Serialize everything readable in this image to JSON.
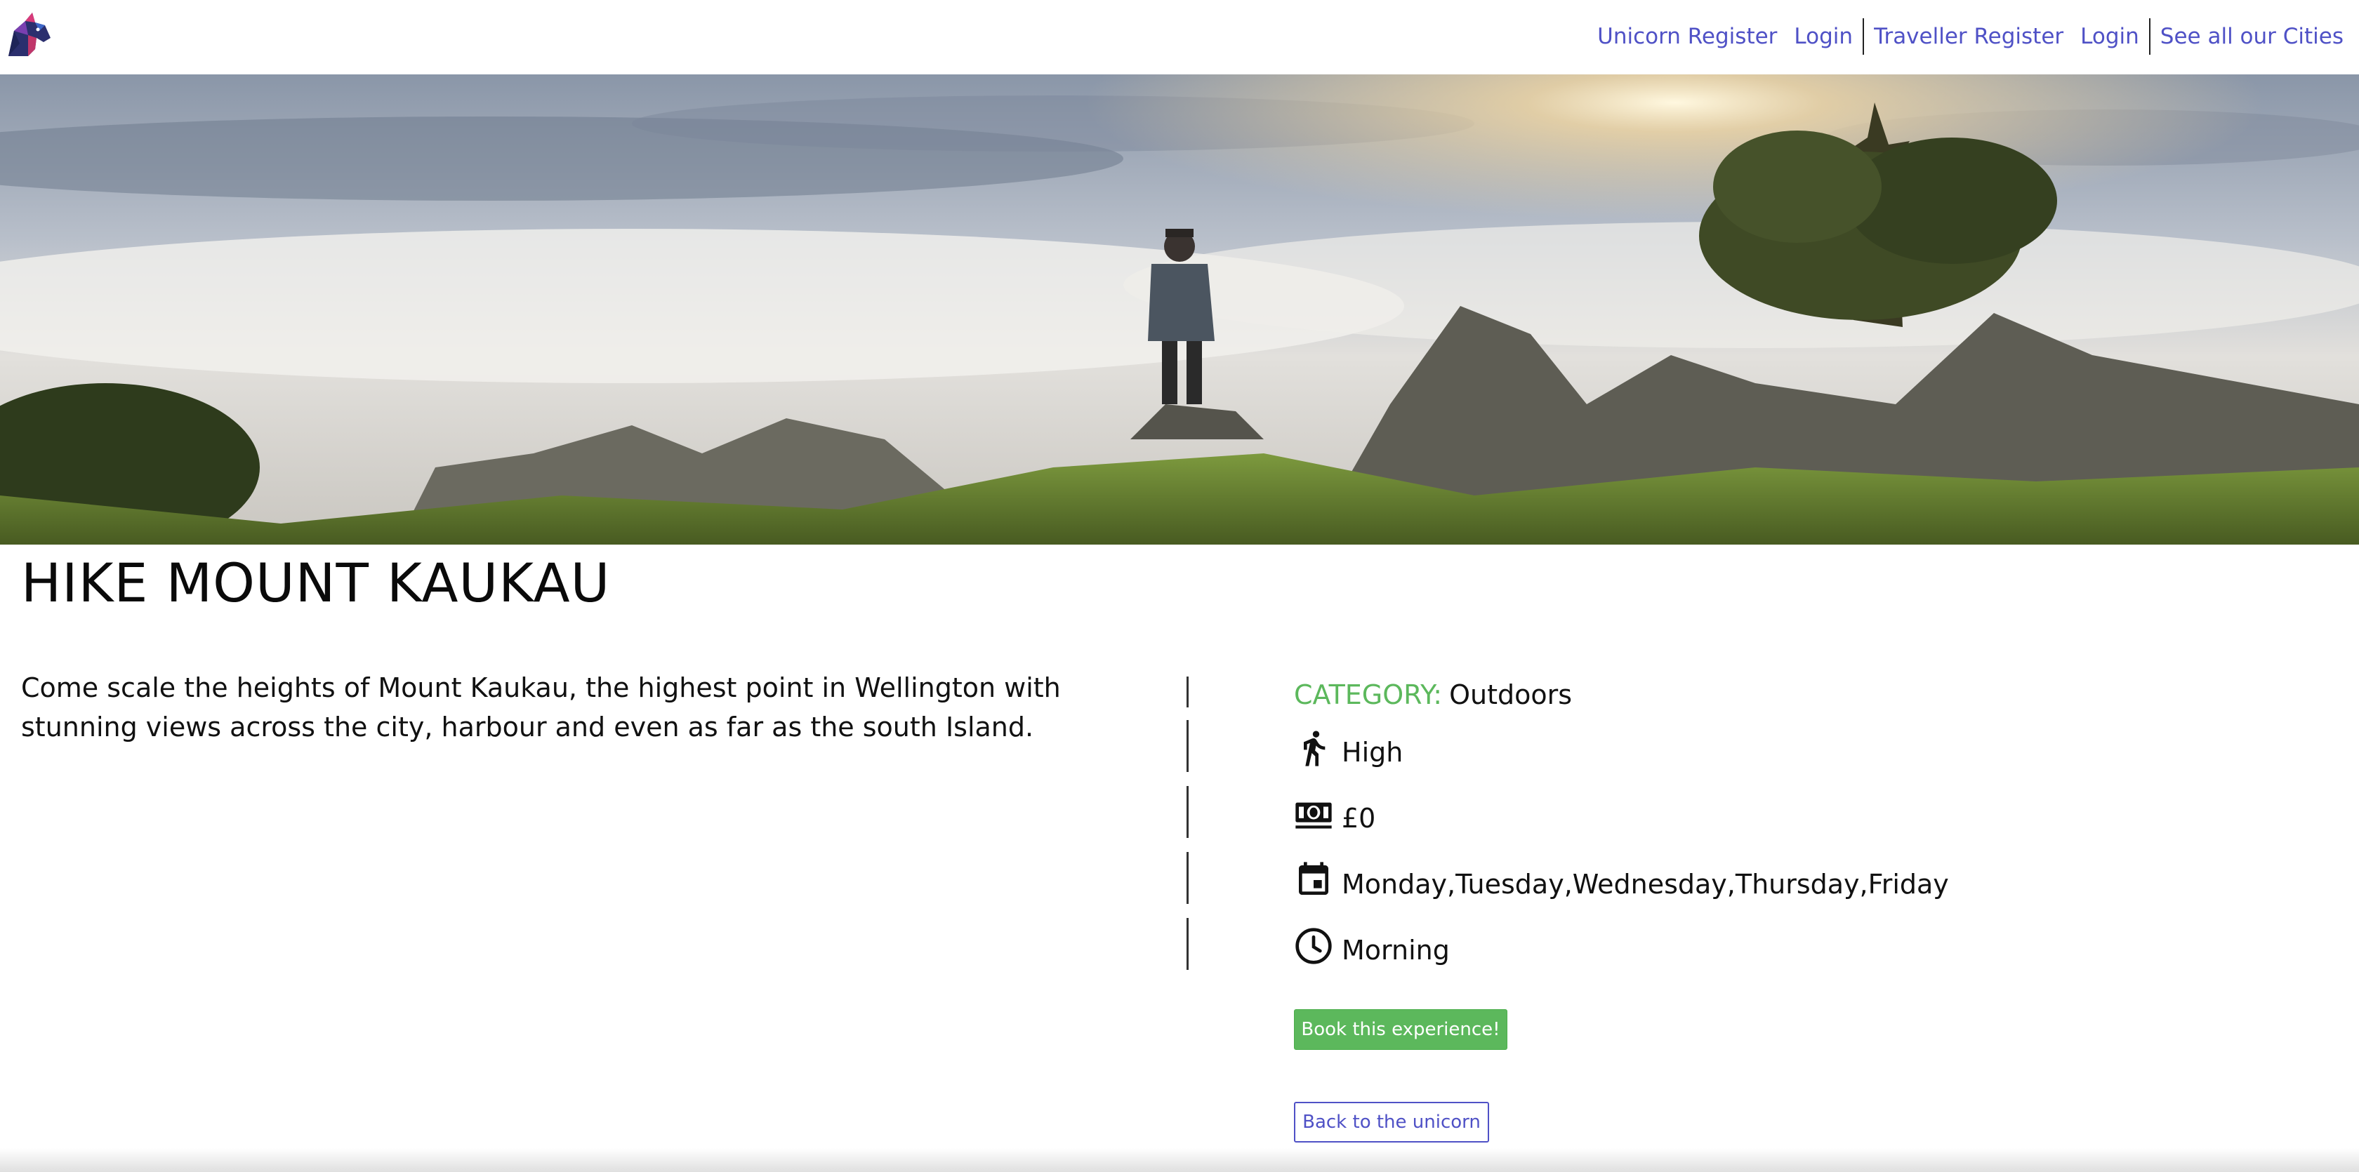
{
  "nav": {
    "logo_icon": "unicorn-logo-icon",
    "links": [
      {
        "label": "Unicorn Register"
      },
      {
        "label": "Login"
      },
      {
        "label": "Traveller Register"
      },
      {
        "label": "Login"
      },
      {
        "label": "See all our Cities"
      }
    ]
  },
  "hero": {
    "image": "hiker-on-mountain-photo"
  },
  "experience": {
    "title": "HIKE MOUNT KAUKAU",
    "description": "Come scale the heights of Mount Kaukau, the highest point in Wellington with stunning views across the city, harbour and even as far as the south Island.",
    "category_label": "CATEGORY:",
    "category_value": "Outdoors",
    "details": [
      {
        "icon": "walking-person-icon",
        "value": "High"
      },
      {
        "icon": "cash-icon",
        "value": "£0"
      },
      {
        "icon": "calendar-icon",
        "value": "Monday,Tuesday,Wednesday,Thursday,Friday"
      },
      {
        "icon": "clock-icon",
        "value": "Morning"
      }
    ]
  },
  "actions": {
    "book_label": "Book this experience!",
    "back_label": "Back to the unicorn"
  },
  "colors": {
    "link": "#4f51c6",
    "accent_green": "#5cb85c"
  }
}
